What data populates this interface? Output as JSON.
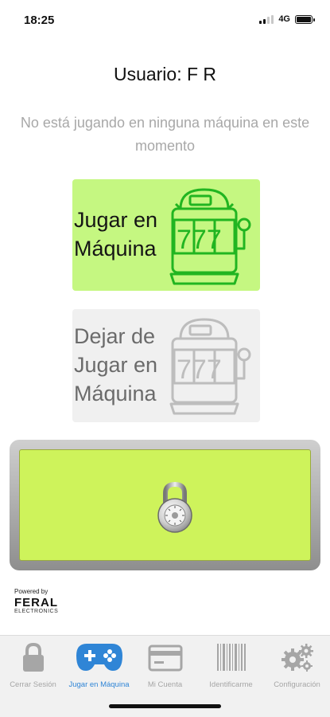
{
  "status_bar": {
    "time": "18:25",
    "network": "4G"
  },
  "header": {
    "user_title": "Usuario: F R"
  },
  "status_message": "No está jugando en ninguna máquina en este momento",
  "buttons": {
    "play_line1": "Jugar en",
    "play_line2": "Máquina",
    "play_icon": "slot-machine-icon",
    "stop_line1": "Dejar de",
    "stop_line2": "Jugar en",
    "stop_line3": "Máquina",
    "stop_icon": "slot-machine-icon",
    "slot_digits": "777",
    "lock_icon": "padlock-icon"
  },
  "branding": {
    "powered_by": "Powered by",
    "logo": "FERAL",
    "logo_sub": "ELECTRONICS"
  },
  "tabs": [
    {
      "label": "Cerrar Sesión",
      "icon": "lock-icon"
    },
    {
      "label": "Jugar en Máquina",
      "icon": "gamepad-icon",
      "active": true
    },
    {
      "label": "Mi Cuenta",
      "icon": "card-icon"
    },
    {
      "label": "Identificarme",
      "icon": "barcode-icon"
    },
    {
      "label": "Configuración",
      "icon": "gears-icon"
    }
  ],
  "colors": {
    "play_bg": "#c5f781",
    "stop_bg": "#f0f0f0",
    "lock_bg": "#cef35b",
    "accent_active": "#2f85d6",
    "inactive_tab": "#a6a6a6"
  }
}
